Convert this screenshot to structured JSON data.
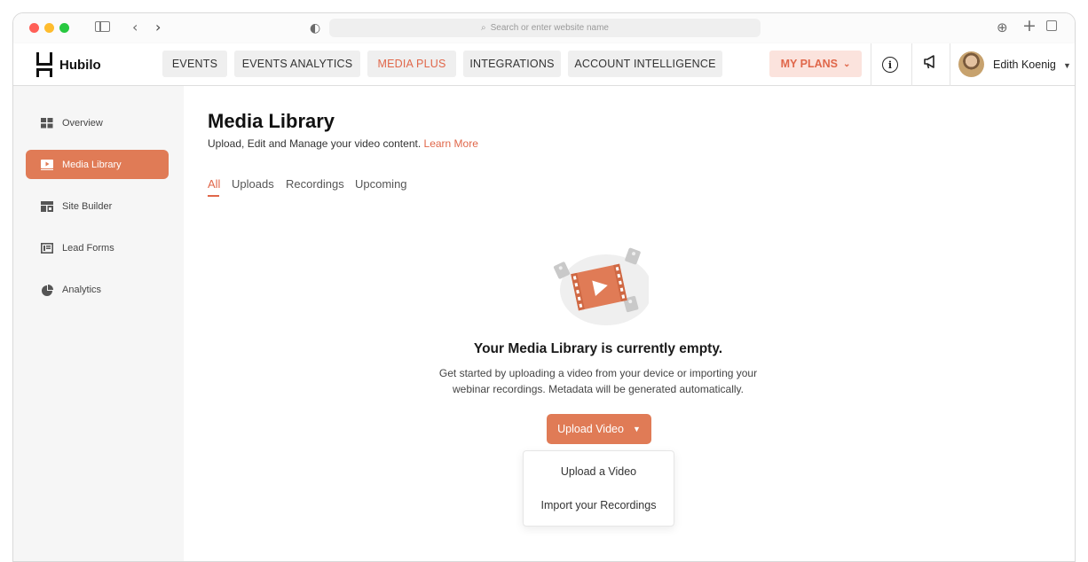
{
  "browser": {
    "url_placeholder": "Search or enter website name"
  },
  "brand": {
    "name": "Hubilo"
  },
  "nav": {
    "items": [
      {
        "label": "EVENTS",
        "active": false
      },
      {
        "label": "EVENTS ANALYTICS",
        "active": false
      },
      {
        "label": "MEDIA PLUS",
        "active": true
      },
      {
        "label": "INTEGRATIONS",
        "active": false
      },
      {
        "label": "ACCOUNT INTELLIGENCE",
        "active": false
      }
    ],
    "my_plans": "MY PLANS"
  },
  "user": {
    "name": "Edith Koenig"
  },
  "sidebar": {
    "items": [
      {
        "label": "Overview",
        "icon": "grid-icon",
        "active": false
      },
      {
        "label": "Media Library",
        "icon": "play-icon",
        "active": true
      },
      {
        "label": "Site Builder",
        "icon": "layout-icon",
        "active": false
      },
      {
        "label": "Lead Forms",
        "icon": "form-icon",
        "active": false
      },
      {
        "label": "Analytics",
        "icon": "pie-chart-icon",
        "active": false
      }
    ]
  },
  "main": {
    "title": "Media Library",
    "subtitle": "Upload, Edit and Manage your video content.",
    "learn_more": "Learn More",
    "tabs": [
      {
        "label": "All",
        "active": true
      },
      {
        "label": "Uploads",
        "active": false
      },
      {
        "label": "Recordings",
        "active": false
      },
      {
        "label": "Upcoming",
        "active": false
      }
    ],
    "empty_title": "Your Media Library is currently empty.",
    "empty_desc_line1": "Get started by uploading a video from your device or importing your",
    "empty_desc_line2": "webinar recordings. Metadata will be generated automatically.",
    "upload_button": "Upload Video",
    "dropdown": {
      "items": [
        "Upload a Video",
        "Import your Recordings"
      ]
    }
  },
  "colors": {
    "accent": "#e07b56",
    "accent_text": "#e0674a",
    "my_plans_bg": "#fbe3dd"
  }
}
